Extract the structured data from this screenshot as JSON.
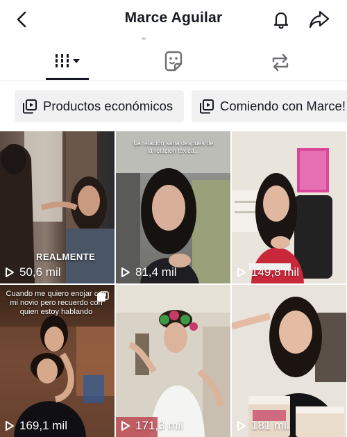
{
  "header": {
    "title": "Marce Aguilar",
    "back_icon": "chevron-left-icon",
    "bell_icon": "bell-icon",
    "share_icon": "share-arrow-icon"
  },
  "tabs": [
    {
      "name": "videos",
      "icon": "grid-filter-icon",
      "selected": true
    },
    {
      "name": "stickers",
      "icon": "sticker-icon",
      "selected": false
    },
    {
      "name": "reposts",
      "icon": "repost-icon",
      "selected": false
    }
  ],
  "playlists": [
    {
      "label": "Productos económicos",
      "icon": "playlist-icon"
    },
    {
      "label": "Comiendo con Marce!",
      "icon": "playlist-icon"
    }
  ],
  "videos": [
    {
      "views": "50,6 mil",
      "overlay": "REALMENTE"
    },
    {
      "views": "81,4 mil",
      "caption": "La relación sana después de la relación tóxica..."
    },
    {
      "views": "149,8 mil"
    },
    {
      "views": "169,1 mil",
      "caption": "Cuando me quiero enojar con mi novio pero recuerdo con quien estoy hablando"
    },
    {
      "views": "171,3 mil"
    },
    {
      "views": "181 mil"
    }
  ],
  "colors": {
    "text": "#161823",
    "chip_bg": "#f1f1f2",
    "divider": "#e6e6e6"
  }
}
